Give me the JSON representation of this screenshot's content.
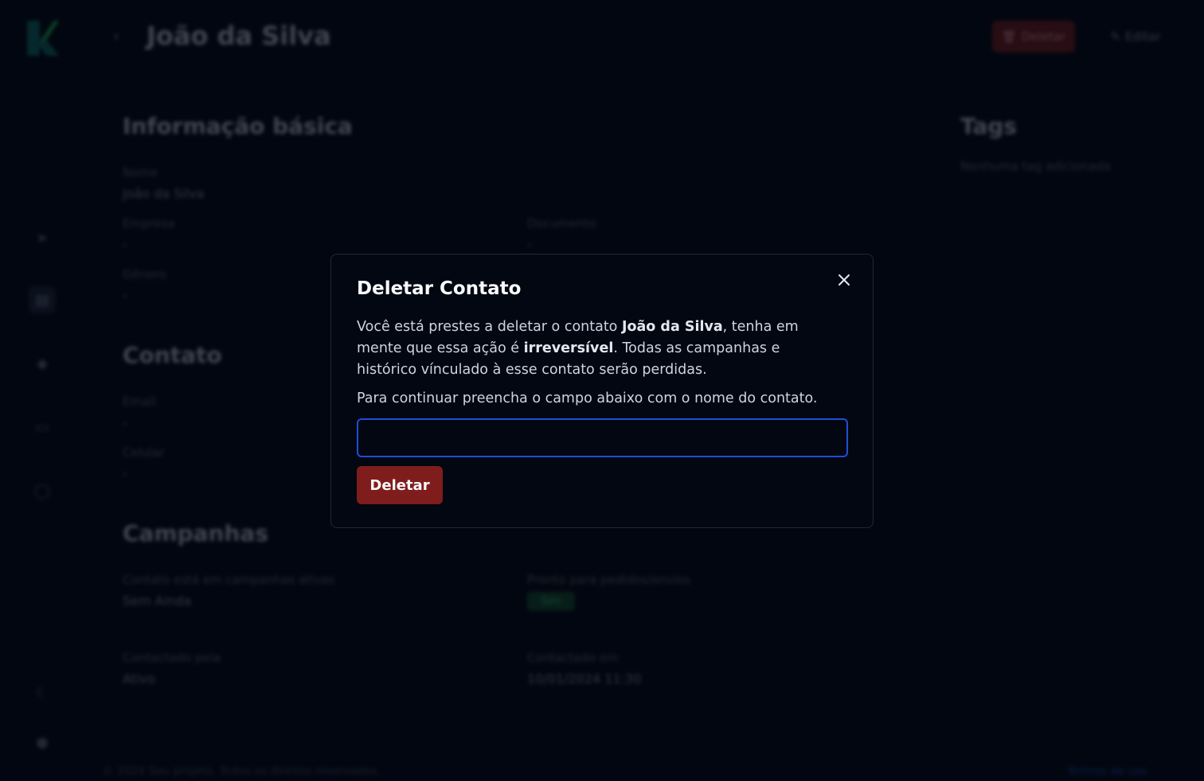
{
  "header": {
    "back_icon": "chevron-left-icon",
    "title": "João da Silva",
    "delete_label": "Deletar",
    "edit_label": "Editar"
  },
  "sidebar": {
    "items": [
      {
        "icon": "send-icon"
      },
      {
        "icon": "contacts-icon",
        "active": true
      },
      {
        "icon": "tag-icon"
      },
      {
        "icon": "message-icon"
      },
      {
        "icon": "help-icon"
      },
      {
        "icon": "moon-icon"
      },
      {
        "icon": "user-icon"
      }
    ]
  },
  "basic_info": {
    "title": "Informação básica",
    "name_label": "Nome",
    "name_value": "João da Silva",
    "company_label": "Empresa",
    "company_value": "-",
    "document_label": "Documento",
    "document_value": "-",
    "gender_label": "Gênero",
    "gender_value": "-"
  },
  "contact": {
    "title": "Contato",
    "email_label": "Email",
    "email_value": "-",
    "phone_label": "Celular",
    "phone_value": "-"
  },
  "campaigns": {
    "title": "Campanhas",
    "active_label": "Contato está em campanhas ativas",
    "active_value": "Sem Ainda",
    "available_label": "Pronto para pedidos/envios",
    "available_value": "Sim",
    "contacted_label": "Contactado pela",
    "contacted_value": "Ativo",
    "contacted_at_label": "Contactado em",
    "contacted_at_value": "10/01/2024 11:30"
  },
  "tags": {
    "title": "Tags",
    "empty": "Nenhuma tag adicionada"
  },
  "footer": {
    "left": "© 2024 Seu projeto. Todos os direitos reservados.",
    "right": "Termos de uso"
  },
  "modal": {
    "title": "Deletar Contato",
    "close_icon": "close-icon",
    "text_part1": "Você está prestes a deletar o contato ",
    "text_name": "João da Silva",
    "text_part2": ", tenha em mente que essa ação é ",
    "text_irrev": "irreversível",
    "text_part3": ". Todas as campanhas e histórico vínculado à esse contato serão perdidas.",
    "hint": "Para continuar preencha o campo abaixo com o nome do contato.",
    "input_value": "",
    "input_placeholder": "",
    "delete_label": "Deletar"
  },
  "colors": {
    "background": "#030711",
    "danger": "#7f1d1d",
    "focus_ring": "#1d4ed8",
    "accent_green": "#22c55e"
  }
}
